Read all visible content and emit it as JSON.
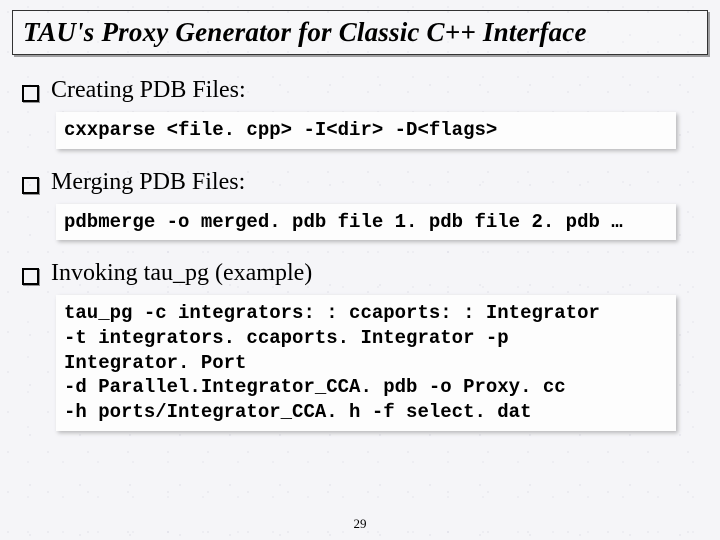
{
  "title": "TAU's Proxy Generator for Classic C++ Interface",
  "bullets": {
    "b1": {
      "label": "Creating PDB Files:",
      "code": "cxxparse <file. cpp> -I<dir> -D<flags>"
    },
    "b2": {
      "label": "Merging PDB Files:",
      "code": "pdbmerge -o merged. pdb file 1. pdb file 2. pdb …"
    },
    "b3": {
      "label": "Invoking tau_pg (example)",
      "code": "tau_pg -c integrators: : ccaports: : Integrator\n-t integrators. ccaports. Integrator -p\nIntegrator. Port\n-d Parallel.Integrator_CCA. pdb -o Proxy. cc\n-h ports/Integrator_CCA. h -f select. dat"
    }
  },
  "page_number": "29"
}
